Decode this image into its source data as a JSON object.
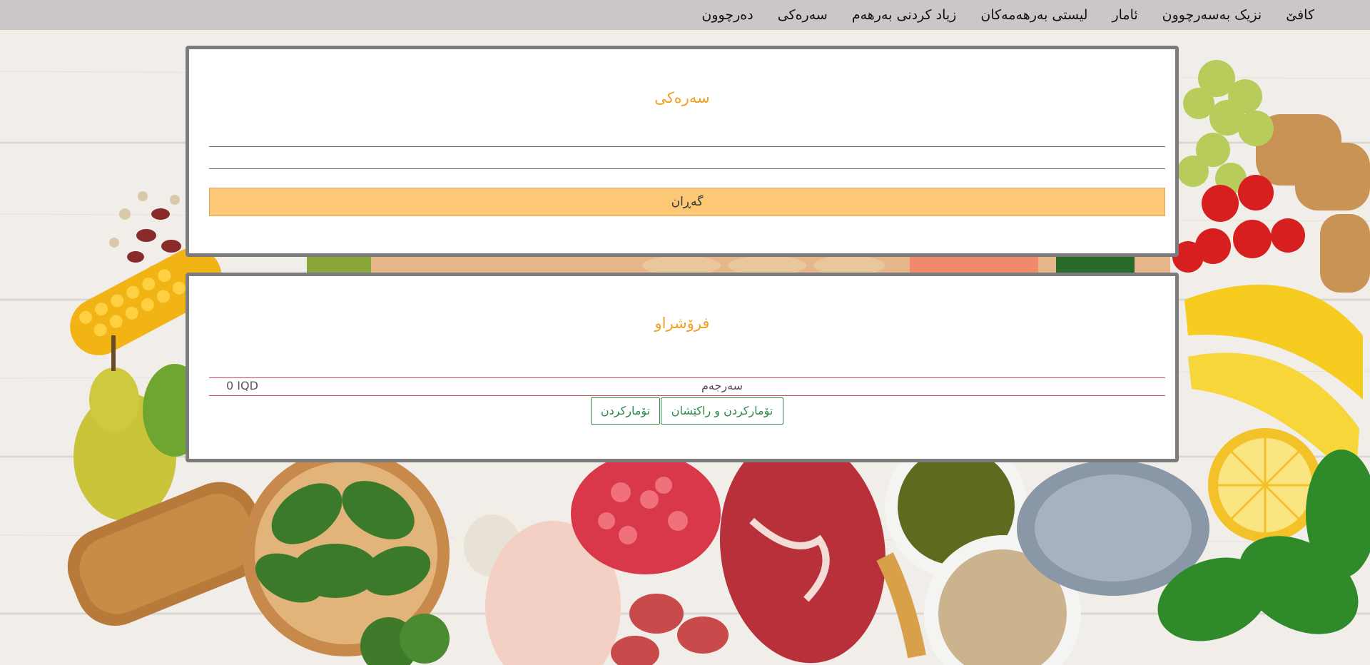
{
  "nav": {
    "items": [
      {
        "label": "کافێ"
      },
      {
        "label": "نزیک بەسەرچوون"
      },
      {
        "label": "ئامار"
      },
      {
        "label": "لیستی بەرهەمەکان"
      },
      {
        "label": "زیاد کردنی بەرهەم"
      },
      {
        "label": "سەرەکی"
      },
      {
        "label": "دەرچوون"
      }
    ]
  },
  "search_panel": {
    "title": "سەرەکی",
    "field1": {
      "value": "",
      "placeholder": ""
    },
    "field2": {
      "value": "",
      "placeholder": ""
    },
    "search_label": "گەڕان"
  },
  "sold_panel": {
    "title": "فرۆشراو",
    "total_label": "سەرجەم",
    "total_value": "0 IQD",
    "register_print_label": "تۆمارکردن و راکێشان",
    "register_label": "تۆمارکردن"
  },
  "colors": {
    "nav_bg": "#cdc6c8",
    "title_accent": "#f0a020",
    "search_button_bg": "#fdc876",
    "total_border": "#d24a5a",
    "action_button": "#2e8a4a",
    "panel_border": "#7c7c7c"
  }
}
